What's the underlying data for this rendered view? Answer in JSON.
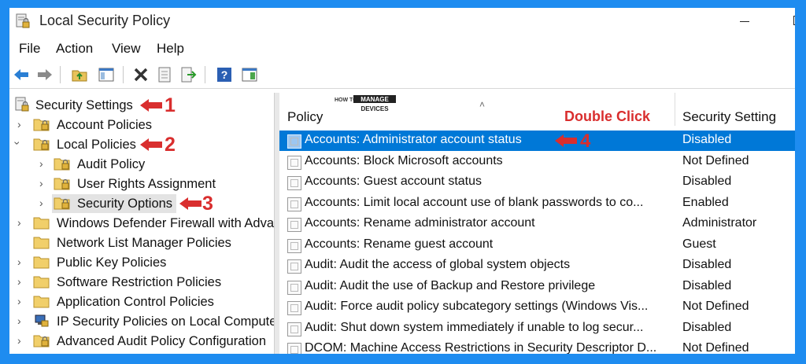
{
  "window": {
    "title": "Local Security Policy"
  },
  "menu": [
    "File",
    "Action",
    "View",
    "Help"
  ],
  "toolbar": {
    "icons": [
      "back-arrow-icon",
      "forward-arrow-icon",
      "up-folder-icon",
      "show-hide-tree-icon",
      "delete-icon",
      "properties-icon",
      "export-list-icon",
      "help-icon",
      "console-icon"
    ]
  },
  "watermark": {
    "line1": "HOW TO",
    "line2": "MANAGE",
    "line3": "DEVICES"
  },
  "tree": [
    {
      "label": "Security Settings",
      "annotation": "1"
    },
    {
      "label": "Account Policies"
    },
    {
      "label": "Local Policies",
      "annotation": "2"
    },
    {
      "label": "Audit Policy"
    },
    {
      "label": "User Rights Assignment"
    },
    {
      "label": "Security Options",
      "annotation": "3"
    },
    {
      "label": "Windows Defender Firewall with Adva"
    },
    {
      "label": "Network List Manager Policies"
    },
    {
      "label": "Public Key Policies"
    },
    {
      "label": "Software Restriction Policies"
    },
    {
      "label": "Application Control Policies"
    },
    {
      "label": "IP Security Policies on Local Compute"
    },
    {
      "label": "Advanced Audit Policy Configuration"
    }
  ],
  "columns": {
    "policy": "Policy",
    "setting": "Security Setting"
  },
  "double_click_label": "Double Click",
  "row_annotation": "4",
  "rows": [
    {
      "policy": "Accounts: Administrator account status",
      "setting": "Disabled"
    },
    {
      "policy": "Accounts: Block Microsoft accounts",
      "setting": "Not Defined"
    },
    {
      "policy": "Accounts: Guest account status",
      "setting": "Disabled"
    },
    {
      "policy": "Accounts: Limit local account use of blank passwords to co...",
      "setting": "Enabled"
    },
    {
      "policy": "Accounts: Rename administrator account",
      "setting": "Administrator"
    },
    {
      "policy": "Accounts: Rename guest account",
      "setting": "Guest"
    },
    {
      "policy": "Audit: Audit the access of global system objects",
      "setting": "Disabled"
    },
    {
      "policy": "Audit: Audit the use of Backup and Restore privilege",
      "setting": "Disabled"
    },
    {
      "policy": "Audit: Force audit policy subcategory settings (Windows Vis...",
      "setting": "Not Defined"
    },
    {
      "policy": "Audit: Shut down system immediately if unable to log secur...",
      "setting": "Disabled"
    },
    {
      "policy": "DCOM: Machine Access Restrictions in Security Descriptor D...",
      "setting": "Not Defined"
    }
  ]
}
